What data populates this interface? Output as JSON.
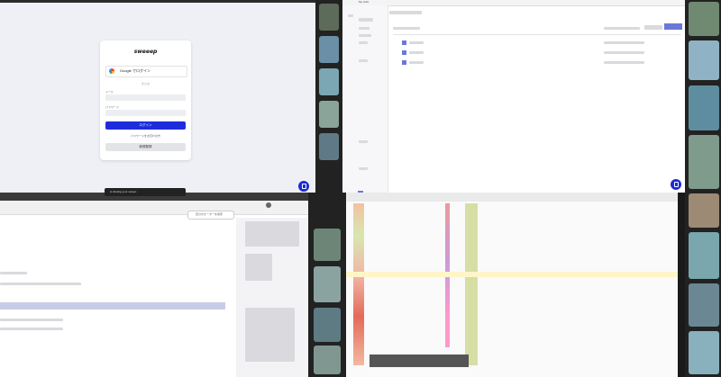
{
  "login": {
    "logo_text": "sweeep",
    "google_button": "Google でログイン",
    "or_text": "または",
    "email_label": "メール",
    "password_label": "パスワード",
    "login_button": "ログイン",
    "forgot_link": "パスワードをお忘れの方",
    "signup_button": "新規登録"
  },
  "app_window": {
    "title_app": "My Jobs"
  },
  "browser": {
    "notice_text": "is sharing your screen",
    "search_placeholder": "自分のオーダーを検索"
  },
  "colors": {
    "accent": "#1e2ddc",
    "login_bg": "#eef0f5"
  }
}
